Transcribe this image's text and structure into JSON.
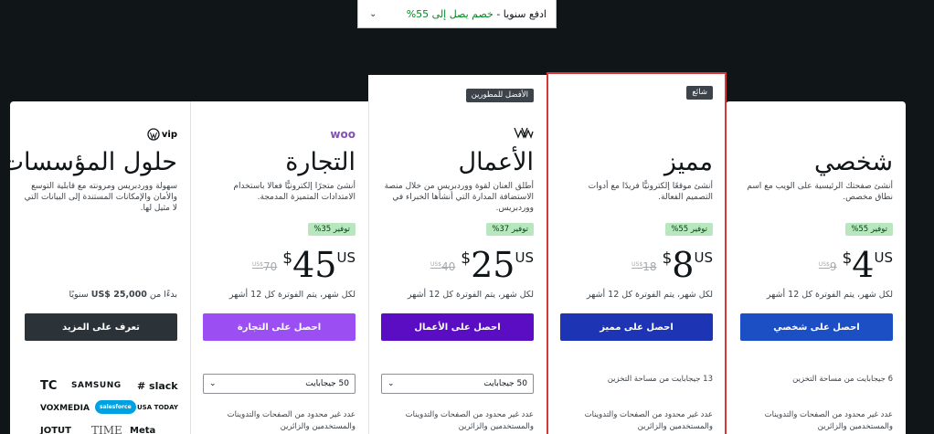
{
  "billing": {
    "prefix": "ادفع سنويا",
    "sep": " - ",
    "discount": "خصم يصل إلى 55%"
  },
  "plans": [
    {
      "id": "personal",
      "name": "شخصي",
      "desc": "أنشئ صفحتك الرئيسية على الويب مع اسم نطاق مخصص.",
      "save": "توفير 55%",
      "old_price": "9",
      "old_currency": "US$",
      "currency": "$",
      "price": "4",
      "currency_suffix": "US",
      "period": "لكل شهر، يتم الفوترة كل 12 أشهر",
      "cta": "احصل على شخصي",
      "cta_color": "#1d4fc4",
      "storage": "6 جيجابايت من مساحة التخزين",
      "unlimited": "عدد غير محدود من الصفحات والتدوينات والمستخدمين والزائرين"
    },
    {
      "id": "premium",
      "name": "مميز",
      "badge": "شائع",
      "desc": "أنشئ موقعًا إلكترونيًّا فريدًا مع أدوات التصميم الفعالة.",
      "save": "توفير 55%",
      "old_price": "18",
      "old_currency": "US$",
      "currency": "$",
      "price": "8",
      "currency_suffix": "US",
      "period": "لكل شهر، يتم الفوترة كل 12 أشهر",
      "cta": "احصل على مميز",
      "cta_color": "#1d35b4",
      "storage": "13 جيجابايت من مساحة التخزين",
      "unlimited": "عدد غير محدود من الصفحات والتدوينات والمستخدمين والزائرين"
    },
    {
      "id": "business",
      "name": "الأعمال",
      "badge": "الأفضل للمطورين",
      "desc": "أطلق العنان لقوة ووردبريس من خلال منصة الاستضافة المدارة التي أنشأها الخبراء في ووردبريس.",
      "save": "توفير 37%",
      "old_price": "40",
      "old_currency": "US$",
      "currency": "$",
      "price": "25",
      "currency_suffix": "US",
      "period": "لكل شهر، يتم الفوترة كل 12 أشهر",
      "cta": "احصل على الأعمال",
      "cta_color": "#5b0dc4",
      "storage_option": "50 جيجابايت",
      "unlimited": "عدد غير محدود من الصفحات والتدوينات والمستخدمين والزائرين"
    },
    {
      "id": "commerce",
      "name": "التجارة",
      "logo": "woo",
      "desc": "أنشئ متجرًا إلكترونيًّا فعالا باستخدام الامتدادات المتميزة المدمجة.",
      "save": "توفير 35%",
      "old_price": "70",
      "old_currency": "US$",
      "currency": "$",
      "price": "45",
      "currency_suffix": "US",
      "period": "لكل شهر، يتم الفوترة كل 12 أشهر",
      "cta": "احصل على التجارة",
      "cta_color": "#9b4ff2",
      "storage_option": "50 جيجابايت",
      "unlimited": "عدد غير محدود من الصفحات والتدوينات والمستخدمين والزائرين"
    },
    {
      "id": "enterprise",
      "name": "حلول المؤسسات",
      "logo": "vip",
      "desc": "سهولة ووردبريس ومرونته مع قابلية التوسع والأمان والإمكانات المستندة إلى البيانات التي لا مثيل لها.",
      "starting_prefix": "بدءًا من",
      "starting_amount": "US$ 25,000",
      "starting_suffix": "سنويًا",
      "cta": "تعرف على المزيد",
      "cta_color": "#2c3338",
      "clients": [
        "TC",
        "SAMSUNG",
        "slack",
        "VOXMEDIA",
        "salesforce",
        "USA TODAY",
        "JOTUT",
        "TIME",
        "Meta"
      ]
    }
  ],
  "colors": {
    "background": "#101517",
    "highlight": "#d63638",
    "save_bg": "#b8e6bf"
  }
}
